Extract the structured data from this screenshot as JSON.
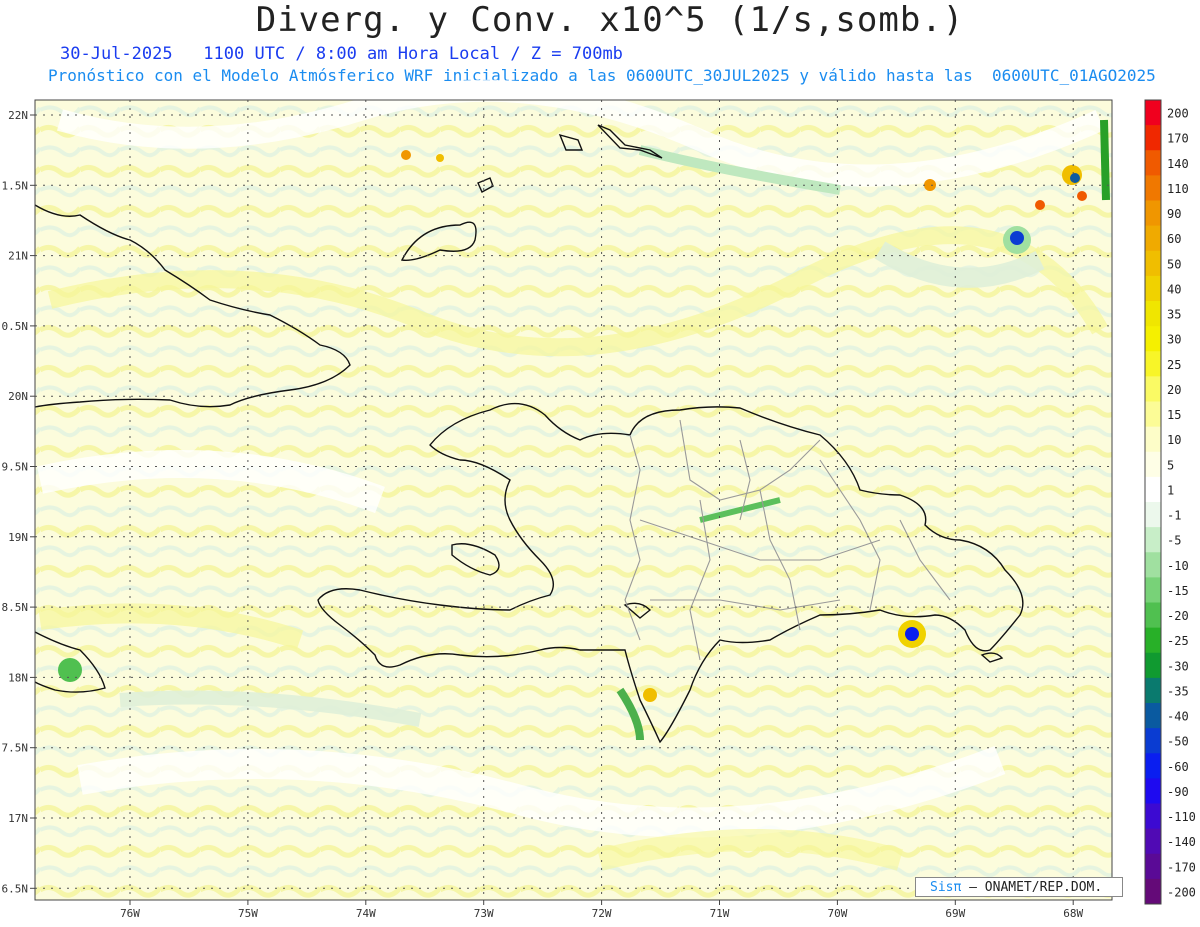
{
  "header": {
    "title": "Diverg. y Conv. x10^5 (1/s,somb.)",
    "date_line": "30-Jul-2025   1100 UTC / 8:00 am Hora Local / Z = 700mb",
    "model_line": "Pronóstico con el Modelo Atmósferico WRF inicializado a las 0600UTC_30JUL2025 y válido hasta las  0600UTC_01AGO2025"
  },
  "axes": {
    "lat_labels": [
      "22N",
      "1.5N",
      "21N",
      "0.5N",
      "20N",
      "9.5N",
      "19N",
      "8.5N",
      "18N",
      "7.5N",
      "17N",
      "6.5N"
    ],
    "lon_labels": [
      "76W",
      "75W",
      "74W",
      "73W",
      "72W",
      "71W",
      "70W",
      "69W",
      "68W"
    ]
  },
  "colorbar": {
    "labels": [
      "200",
      "170",
      "140",
      "110",
      "90",
      "60",
      "50",
      "40",
      "35",
      "30",
      "25",
      "20",
      "15",
      "10",
      "5",
      "1",
      "-1",
      "-5",
      "-10",
      "-15",
      "-20",
      "-25",
      "-30",
      "-35",
      "-40",
      "-50",
      "-60",
      "-90",
      "-110",
      "-140",
      "-170",
      "-200"
    ],
    "colors": [
      "#f0001e",
      "#f02800",
      "#f05a00",
      "#f07800",
      "#f09600",
      "#f0aa00",
      "#f0be00",
      "#f0d200",
      "#f0e600",
      "#f5f000",
      "#f8f528",
      "#fafa64",
      "#fcfc96",
      "#fdfdc8",
      "#fefee6",
      "#ffffff",
      "#ecf8ec",
      "#c8eec8",
      "#a0e0a0",
      "#78d278",
      "#50c050",
      "#28b028",
      "#109a30",
      "#0a7a6e",
      "#0a5aa0",
      "#0a3cd2",
      "#0a1ef0",
      "#1e0af0",
      "#3c0ad2",
      "#500ab4",
      "#5a0a96",
      "#640a78"
    ]
  },
  "credit": {
    "sis": "Sisπ",
    "org": "– ONAMET/REP.DOM."
  }
}
